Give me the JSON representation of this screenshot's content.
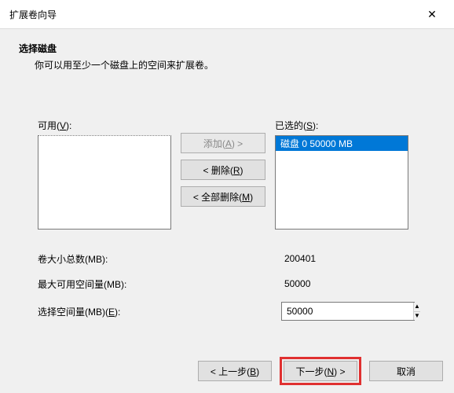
{
  "window": {
    "title": "扩展卷向导"
  },
  "header": {
    "heading": "选择磁盘",
    "sub": "你可以用至少一个磁盘上的空间来扩展卷。"
  },
  "lists": {
    "available_label_pre": "可用(",
    "available_hotkey": "V",
    "available_label_post": "):",
    "selected_label_pre": "已选的(",
    "selected_hotkey": "S",
    "selected_label_post": "):",
    "selected_items": [
      {
        "text": "磁盘 0       50000 MB"
      }
    ]
  },
  "buttons": {
    "add_pre": "添加(",
    "add_hk": "A",
    "add_post": ") >",
    "remove_pre": "< 删除(",
    "remove_hk": "R",
    "remove_post": ")",
    "remove_all_pre": "< 全部删除(",
    "remove_all_hk": "M",
    "remove_all_post": ")"
  },
  "fields": {
    "total_label": "卷大小总数(MB):",
    "total_value": "200401",
    "max_label": "最大可用空间量(MB):",
    "max_value": "50000",
    "select_label_pre": "选择空间量(MB)(",
    "select_hk": "E",
    "select_label_post": "):",
    "select_value": "50000"
  },
  "footer": {
    "back_pre": "< 上一步(",
    "back_hk": "B",
    "back_post": ")",
    "next_pre": "下一步(",
    "next_hk": "N",
    "next_post": ") >",
    "cancel": "取消"
  }
}
